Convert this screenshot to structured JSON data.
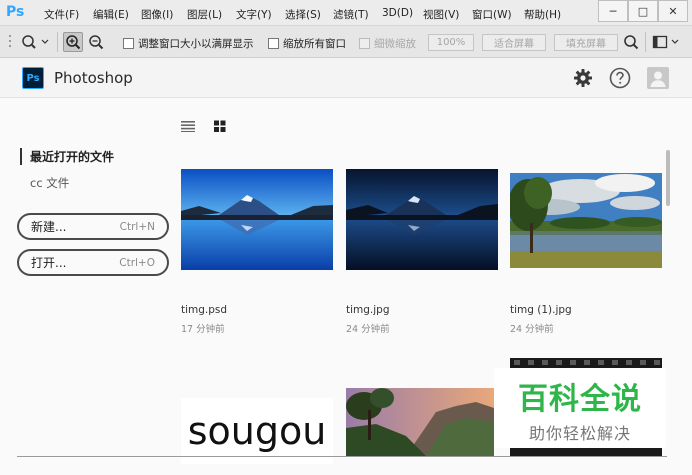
{
  "menubar": {
    "logo": "Ps",
    "items": [
      "文件(F)",
      "编辑(E)",
      "图像(I)",
      "图层(L)",
      "文字(Y)",
      "选择(S)",
      "滤镜(T)",
      "3D(D)",
      "视图(V)",
      "窗口(W)",
      "帮助(H)"
    ],
    "window_controls": {
      "minimize": "─",
      "maximize": "□",
      "close": "✕"
    }
  },
  "toolbar": {
    "resize_windows_label": "调整窗口大小以满屏显示",
    "zoom_all_label": "缩放所有窗口",
    "scrubby_zoom_label": "细微缩放",
    "zoom_100_label": "100%",
    "fit_screen_label": "适合屏幕",
    "fill_screen_label": "填充屏幕"
  },
  "header": {
    "logo": "Ps",
    "title": "Photoshop"
  },
  "sidebar": {
    "recent_title": "最近打开的文件",
    "cc_files": "cc 文件",
    "new_label": "新建...",
    "new_shortcut": "Ctrl+N",
    "open_label": "打开...",
    "open_shortcut": "Ctrl+O"
  },
  "files": [
    {
      "name": "timg.psd",
      "time": "17 分钟前"
    },
    {
      "name": "timg.jpg",
      "time": "24 分钟前"
    },
    {
      "name": "timg (1).jpg",
      "time": "24 分钟前"
    }
  ],
  "partial_thumb_text": "sougou",
  "watermark": {
    "title": "百科全说",
    "subtitle": "助你轻松解决"
  },
  "colors": {
    "ps_blue": "#31a8ff",
    "ps_dark": "#001e36",
    "watermark_green": "#2fb64a"
  }
}
